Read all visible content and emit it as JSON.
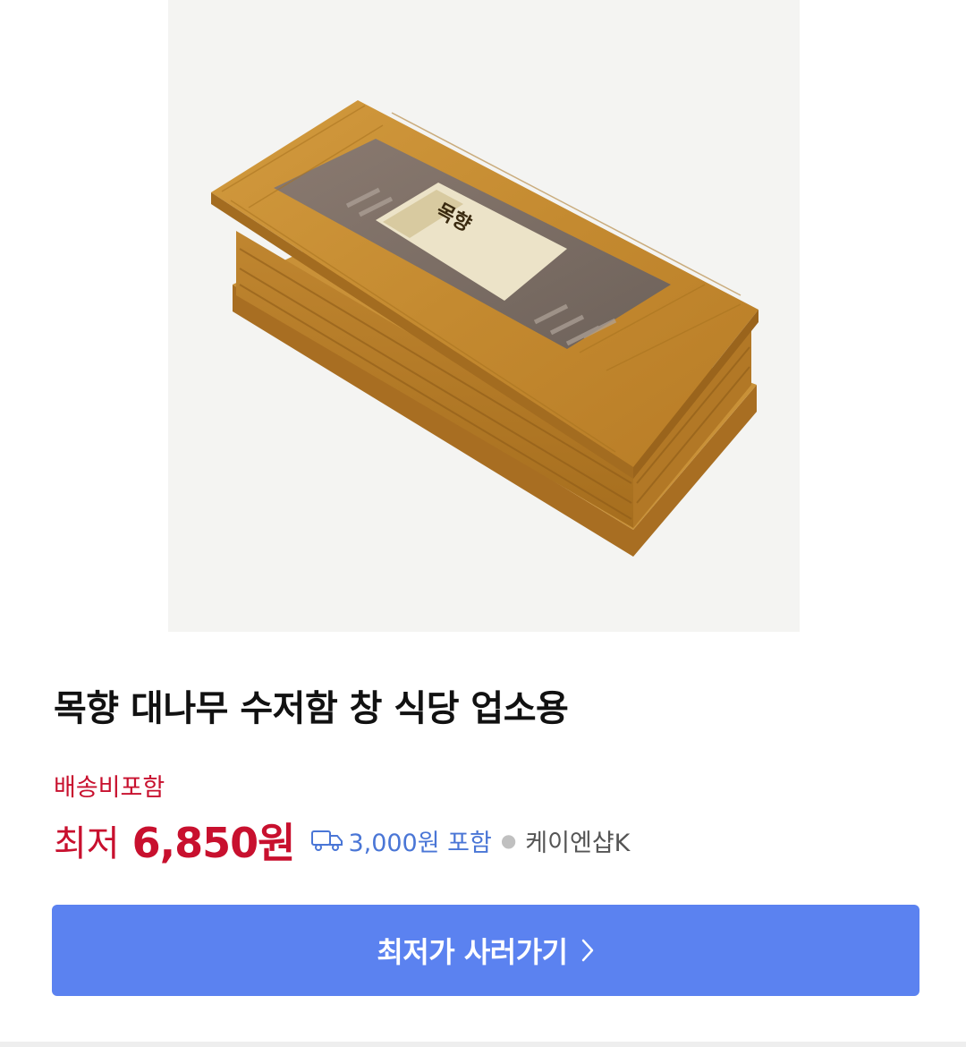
{
  "product": {
    "title": "목향 대나무 수저함 창 식당 업소용",
    "shipping_note": "배송비포함",
    "price_prefix": "최저",
    "price": "6,850원",
    "shipping_fee": "3,000원 포함",
    "seller": "케이엔샵K"
  },
  "image": {
    "alt": "대나무 수저함 상품 이미지",
    "package_label": "목향"
  },
  "actions": {
    "buy_label": "최저가 사러가기",
    "expand_icon": "expand-arrows-icon",
    "chevron_icon": "chevron-right-icon",
    "truck_icon": "delivery-truck-icon"
  },
  "colors": {
    "price_red": "#c8102e",
    "shipping_blue": "#4a76d6",
    "button_blue": "#5b82f0"
  }
}
